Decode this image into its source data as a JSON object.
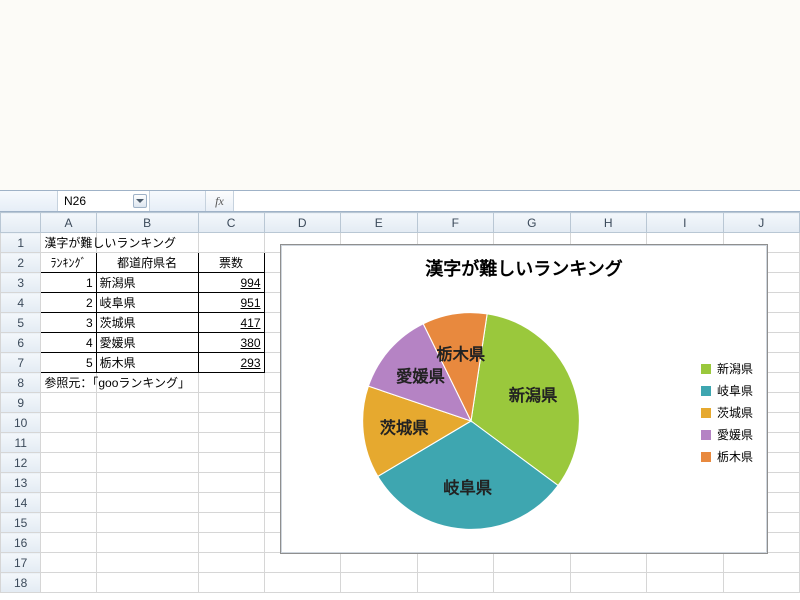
{
  "formula_bar": {
    "namebox_value": "N26",
    "fx_symbol": "fx",
    "formula_value": ""
  },
  "columns": [
    "A",
    "B",
    "C",
    "D",
    "E",
    "F",
    "G",
    "H",
    "I",
    "J"
  ],
  "rows_visible": [
    1,
    2,
    3,
    4,
    5,
    6,
    7,
    8,
    9,
    10,
    11,
    12,
    13,
    14,
    15,
    16,
    17,
    18
  ],
  "cells": {
    "A1": "漢字が難しいランキング",
    "A2": "ﾗﾝｷﾝｸﾞ",
    "B2": "都道府県名",
    "C2": "票数",
    "A3": "1",
    "B3": "新潟県",
    "C3": "994",
    "A4": "2",
    "B4": "岐阜県",
    "C4": "951",
    "A5": "3",
    "B5": "茨城県",
    "C5": "417",
    "A6": "4",
    "B6": "愛媛県",
    "C6": "380",
    "A7": "5",
    "B7": "栃木県",
    "C7": "293",
    "A8": "参照元：「gooランキング」"
  },
  "chart_data": {
    "type": "pie",
    "title": "漢字が難しいランキング",
    "categories": [
      "新潟県",
      "岐阜県",
      "茨城県",
      "愛媛県",
      "栃木県"
    ],
    "values": [
      994,
      951,
      417,
      380,
      293
    ],
    "colors": [
      "#9ac83c",
      "#3ea6b0",
      "#e6a92f",
      "#b583c4",
      "#e8893e"
    ],
    "legend_position": "right",
    "slice_labels": true
  }
}
